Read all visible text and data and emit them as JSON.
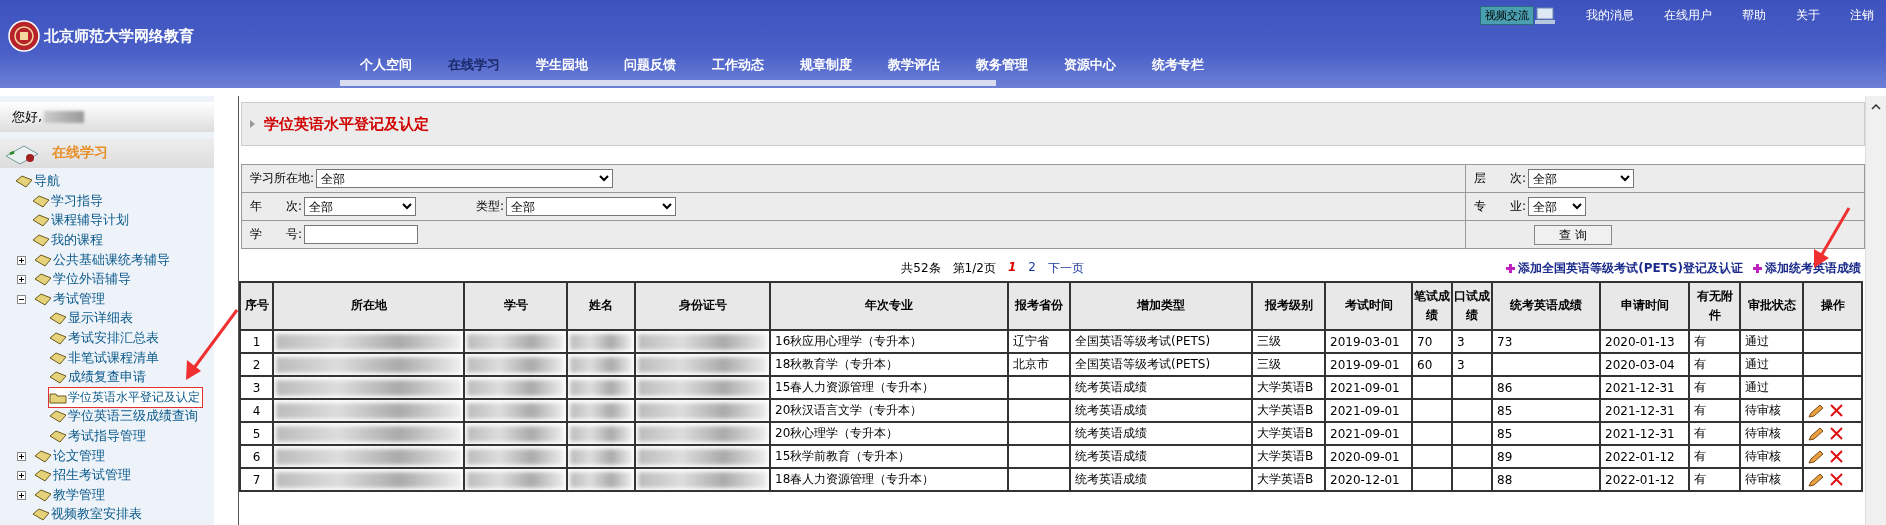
{
  "header": {
    "logo_text": "北京师范大学网络教育",
    "video_button": "视频交流",
    "links": [
      "我的消息",
      "在线用户",
      "帮助",
      "关于",
      "注销"
    ],
    "nav": [
      {
        "label": "个人空间",
        "selected": false
      },
      {
        "label": "在线学习",
        "selected": true
      },
      {
        "label": "学生园地",
        "selected": false
      },
      {
        "label": "问题反馈",
        "selected": false
      },
      {
        "label": "工作动态",
        "selected": false
      },
      {
        "label": "规章制度",
        "selected": false
      },
      {
        "label": "教学评估",
        "selected": false
      },
      {
        "label": "教务管理",
        "selected": false
      },
      {
        "label": "资源中心",
        "selected": false
      },
      {
        "label": "统考专栏",
        "selected": false
      }
    ]
  },
  "sidebar": {
    "greeting": "您好,",
    "section_title": "在线学习",
    "tree": [
      {
        "label": "导航",
        "selected": false,
        "children": [
          {
            "label": "学习指导",
            "selected": false
          },
          {
            "label": "课程辅导计划",
            "selected": false
          },
          {
            "label": "我的课程",
            "selected": false
          },
          {
            "label": "公共基础课统考辅导",
            "selected": false,
            "expanded": false
          },
          {
            "label": "学位外语辅导",
            "selected": false,
            "expanded": false
          },
          {
            "label": "考试管理",
            "selected": false,
            "expanded": true,
            "children": [
              {
                "label": "显示详细表",
                "selected": false
              },
              {
                "label": "考试安排汇总表",
                "selected": false
              },
              {
                "label": "非笔试课程清单",
                "selected": false
              },
              {
                "label": "成绩复查申请",
                "selected": false
              },
              {
                "label": "学位英语水平登记及认定",
                "selected": true
              },
              {
                "label": "学位英语三级成绩查询",
                "selected": false
              },
              {
                "label": "考试指导管理",
                "selected": false
              }
            ]
          },
          {
            "label": "论文管理",
            "selected": false,
            "expanded": false
          },
          {
            "label": "招生考试管理",
            "selected": false,
            "expanded": false
          },
          {
            "label": "教学管理",
            "selected": false,
            "expanded": false
          },
          {
            "label": "视频教室安排表",
            "selected": false
          }
        ]
      }
    ]
  },
  "page_title": "学位英语水平登记及认定",
  "filters": {
    "location": {
      "label": "学习所在地:",
      "value": "全部"
    },
    "tier": {
      "label": "层　　次:",
      "value": "全部"
    },
    "year": {
      "label": "年　　次:",
      "value": "全部"
    },
    "type": {
      "label": "类型:",
      "value": "全部"
    },
    "major": {
      "label": "专　　业:",
      "value": "全部"
    },
    "student_no": {
      "label": "学　　号:"
    },
    "query_button": "查 询"
  },
  "pager": {
    "total": "共52条",
    "page_info": "第1/2页",
    "pages": [
      {
        "label": "1",
        "selected": true
      },
      {
        "label": "2",
        "selected": false
      }
    ],
    "next": "下一页"
  },
  "add_links": [
    "添加全国英语等级考试(PETS)登记及认证",
    "添加统考英语成绩"
  ],
  "table": {
    "columns": [
      "序号",
      "所在地",
      "学号",
      "姓名",
      "身份证号",
      "年次专业",
      "报考省份",
      "增加类型",
      "报考级别",
      "考试时间",
      "笔试成绩",
      "口试成绩",
      "统考英语成绩",
      "申请时间",
      "有无附件",
      "审批状态",
      "操作"
    ],
    "rows": [
      {
        "no": "1",
        "major": "16秋应用心理学（专升本）",
        "province": "辽宁省",
        "type": "全国英语等级考试(PETS)",
        "level": "三级",
        "exam_date": "2019-03-01",
        "written": "70",
        "oral": "3",
        "unified": "73",
        "apply_date": "2020-01-13",
        "attachment": "有",
        "status": "通过",
        "editable": false
      },
      {
        "no": "2",
        "major": "18秋教育学（专升本）",
        "province": "北京市",
        "type": "全国英语等级考试(PETS)",
        "level": "三级",
        "exam_date": "2019-09-01",
        "written": "60",
        "oral": "3",
        "apply_date": "2020-03-04",
        "attachment": "有",
        "status": "通过",
        "editable": false
      },
      {
        "no": "3",
        "major": "15春人力资源管理（专升本）",
        "type": "统考英语成绩",
        "level": "大学英语B",
        "exam_date": "2021-09-01",
        "unified": "86",
        "apply_date": "2021-12-31",
        "attachment": "有",
        "status": "通过",
        "editable": false
      },
      {
        "no": "4",
        "major": "20秋汉语言文学（专升本）",
        "type": "统考英语成绩",
        "level": "大学英语B",
        "exam_date": "2021-09-01",
        "unified": "85",
        "apply_date": "2021-12-31",
        "attachment": "有",
        "status": "待审核",
        "editable": true
      },
      {
        "no": "5",
        "major": "20秋心理学（专升本）",
        "type": "统考英语成绩",
        "level": "大学英语B",
        "exam_date": "2021-09-01",
        "unified": "85",
        "apply_date": "2021-12-31",
        "attachment": "有",
        "status": "待审核",
        "editable": true
      },
      {
        "no": "6",
        "major": "15秋学前教育（专升本）",
        "type": "统考英语成绩",
        "level": "大学英语B",
        "exam_date": "2020-09-01",
        "unified": "89",
        "apply_date": "2022-01-12",
        "attachment": "有",
        "status": "待审核",
        "editable": true
      },
      {
        "no": "7",
        "major": "18春人力资源管理（专升本）",
        "type": "统考英语成绩",
        "level": "大学英语B",
        "exam_date": "2020-12-01",
        "unified": "88",
        "apply_date": "2022-01-12",
        "attachment": "有",
        "status": "待审核",
        "editable": true
      }
    ]
  }
}
